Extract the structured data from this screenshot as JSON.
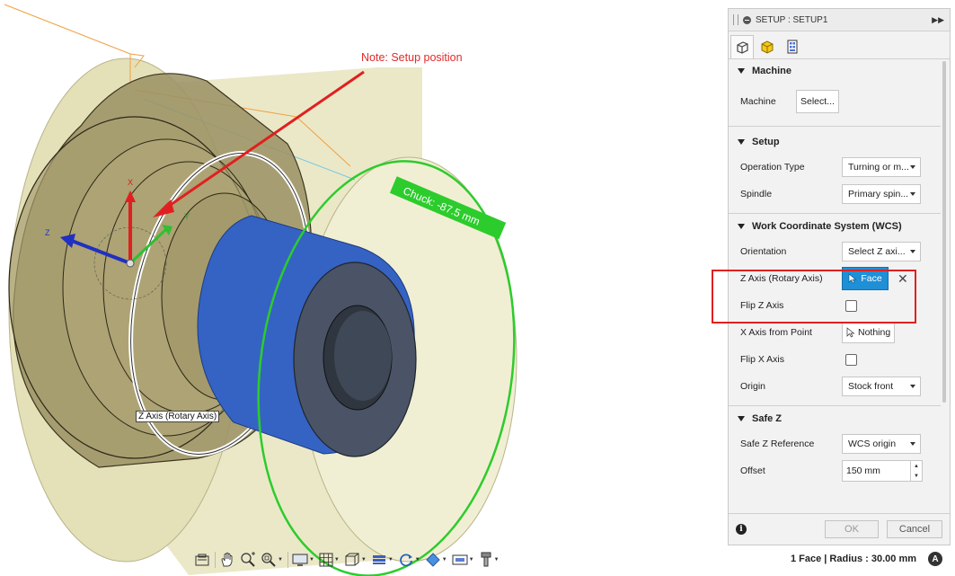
{
  "viewport": {
    "note_label": "Note: Setup position",
    "chuck_label": "Chuck: -87.5 mm",
    "z_axis_label": "Z Axis (Rotary Axis)",
    "axis_x_letter": "X",
    "axis_z_letter": "Z",
    "axis_y_letter": "Y"
  },
  "panel": {
    "title": "SETUP : SETUP1",
    "tabs": [
      "setup-tab",
      "stock-tab",
      "post-process-tab"
    ],
    "groups": {
      "machine": {
        "title": "Machine",
        "machine_label": "Machine",
        "machine_button": "Select..."
      },
      "setup": {
        "title": "Setup",
        "operation_type_label": "Operation Type",
        "operation_type_value": "Turning or m...",
        "spindle_label": "Spindle",
        "spindle_value": "Primary spin..."
      },
      "wcs": {
        "title": "Work Coordinate System (WCS)",
        "orientation_label": "Orientation",
        "orientation_value": "Select Z axi...",
        "z_axis_label": "Z Axis (Rotary Axis)",
        "z_axis_button": "Face",
        "flip_z_label": "Flip Z Axis",
        "x_axis_label": "X Axis from Point",
        "x_axis_button": "Nothing",
        "flip_x_label": "Flip X Axis",
        "origin_label": "Origin",
        "origin_value": "Stock front"
      },
      "safe_z": {
        "title": "Safe Z",
        "reference_label": "Safe Z Reference",
        "reference_value": "WCS origin",
        "offset_label": "Offset",
        "offset_value": "150 mm"
      }
    },
    "ok_label": "OK",
    "cancel_label": "Cancel"
  },
  "status_text": "1 Face | Radius : 30.00 mm",
  "toolbar": {
    "icons": [
      "capture-icon",
      "pan-icon",
      "zoom-window-icon",
      "zoom-fit-icon",
      "display-settings-icon",
      "grid-icon",
      "view-cube-icon",
      "section-icon",
      "orbit-icon",
      "appearance-icon",
      "environment-icon",
      "tool-icon"
    ]
  },
  "colors": {
    "stock": "#e9e6bf",
    "part": "#8c8458",
    "face_highlight": "#2f63c8",
    "chuck": "#2ccc2c",
    "annotation": "#e02020",
    "accent": "#1f8fd6"
  }
}
